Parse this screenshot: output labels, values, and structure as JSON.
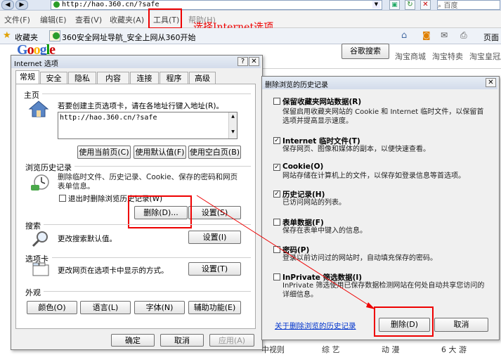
{
  "browser": {
    "address": "http://hao.360.cn/?safe",
    "search_placeholder": "百度",
    "menu": [
      "文件(F)",
      "编辑(E)",
      "查看(V)",
      "收藏夹(A)",
      "工具(T)",
      "帮助(H)"
    ],
    "favorites_label": "收藏夹",
    "tab_title": "360安全网址导航_安全上网从360开始",
    "page_label": "页面",
    "annotation": "选择Internet选项"
  },
  "webpage": {
    "google_button": "谷歌搜索",
    "links": [
      "淘宝商城",
      "淘宝特卖",
      "淘宝皇冠店"
    ],
    "bottom_links": [
      "中视则",
      "综 艺",
      "动 漫",
      "6 大 游"
    ]
  },
  "inet": {
    "title": "Internet 选项",
    "tabs": [
      "常规",
      "安全",
      "隐私",
      "内容",
      "连接",
      "程序",
      "高级"
    ],
    "home": {
      "heading": "主页",
      "desc": "若要创建主页选项卡，请在各地址行键入地址(R)。",
      "url": "http://hao.360.cn/?safe",
      "btn_current": "使用当前页(C)",
      "btn_default": "使用默认值(F)",
      "btn_blank": "使用空白页(B)"
    },
    "history": {
      "heading": "浏览历史记录",
      "desc": "删除临时文件、历史记录、Cookie、保存的密码和网页表单信息。",
      "checkbox": "退出时删除浏览历史记录(W)",
      "btn_delete": "删除(D)...",
      "btn_settings": "设置(S)"
    },
    "search": {
      "heading": "搜索",
      "desc": "更改搜索默认值。",
      "btn": "设置(I)"
    },
    "tabs_section": {
      "heading": "选项卡",
      "desc": "更改网页在选项卡中显示的方式。",
      "btn": "设置(T)"
    },
    "appearance": {
      "heading": "外观",
      "buttons": [
        "颜色(O)",
        "语言(L)",
        "字体(N)",
        "辅助功能(E)"
      ]
    },
    "footer": {
      "ok": "确定",
      "cancel": "取消",
      "apply": "应用(A)"
    }
  },
  "delhist": {
    "title": "删除浏览的历史记录",
    "items": [
      {
        "label": "保留收藏夹网站数据(R)",
        "checked": false,
        "desc": "保留启用收藏夹网站的 Cookie 和 Internet 临时文件，以保留首选项并提高显示速度。"
      },
      {
        "label": "Internet 临时文件(T)",
        "checked": true,
        "desc": "保存网页、图像和媒体的副本，以便快速查看。"
      },
      {
        "label": "Cookie(O)",
        "checked": true,
        "desc": "网站存储在计算机上的文件，以保存如登录信息等首选项。"
      },
      {
        "label": "历史记录(H)",
        "checked": true,
        "desc": "已访问网站的列表。"
      },
      {
        "label": "表单数据(F)",
        "checked": false,
        "desc": "保存在表单中键入的信息。"
      },
      {
        "label": "密码(P)",
        "checked": false,
        "desc": "登录以前访问过的网站时，自动填充保存的密码。"
      },
      {
        "label": "InPrivate 筛选数据(I)",
        "checked": false,
        "desc": "InPrivate 筛选使用已保存数据检测网站在何处自动共享您访问的详细信息。"
      }
    ],
    "link": "关于删除浏览的历史记录",
    "btn_delete": "删除(D)",
    "btn_cancel": "取消"
  }
}
